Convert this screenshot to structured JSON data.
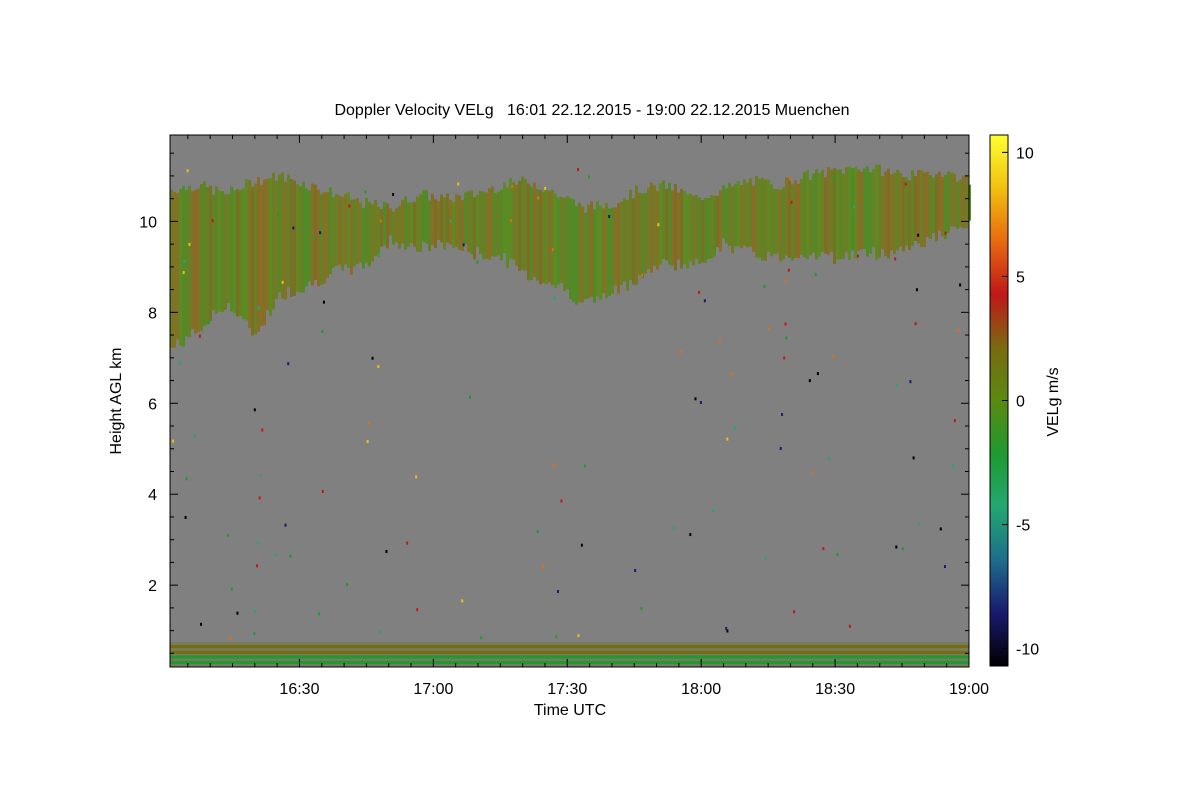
{
  "chart_data": {
    "type": "heatmap",
    "title": "Doppler Velocity VELg   16:01 22.12.2015 - 19:00 22.12.2015 Muenchen",
    "xlabel": "Time UTC",
    "ylabel": "Height AGL km",
    "colorbar_label": "VELg m/s",
    "x_ticks": [
      "16:30",
      "17:00",
      "17:30",
      "18:00",
      "18:30",
      "19:00"
    ],
    "x_tick_values_min": [
      30,
      60,
      90,
      120,
      150,
      180
    ],
    "xlim_min": [
      1,
      180
    ],
    "y_ticks": [
      "2",
      "4",
      "6",
      "8",
      "10"
    ],
    "y_tick_values": [
      2,
      4,
      6,
      8,
      10
    ],
    "ylim": [
      0.2,
      11.9
    ],
    "colorbar_ticks": [
      "10",
      "5",
      "0",
      "-5",
      "-10"
    ],
    "colorbar_tick_values": [
      10,
      5,
      0,
      -5,
      -10
    ],
    "clim": [
      -10.7,
      10.7
    ],
    "background_color": "#808080",
    "colormap": [
      "#000000",
      "#1a1a6e",
      "#1d6e8c",
      "#22a870",
      "#1e9a30",
      "#5a8a10",
      "#7a6a10",
      "#c01818",
      "#e86a10",
      "#f0c010",
      "#ffff30"
    ],
    "cloud_layer": {
      "description_values_m_s": [
        -1.5,
        1.5
      ],
      "top_km": [
        10.7,
        10.8,
        10.6,
        10.9,
        11.0,
        10.8,
        10.6,
        10.4,
        10.3,
        10.6,
        10.5,
        10.6,
        10.8,
        10.9,
        10.6,
        10.3,
        10.4,
        10.7,
        10.8,
        10.5,
        10.7,
        10.9,
        10.8,
        11.0,
        11.1,
        11.2,
        11.1,
        11.0,
        11.1,
        10.9
      ],
      "base_km": [
        7.2,
        7.6,
        8.2,
        7.5,
        8.4,
        8.6,
        8.9,
        9.0,
        9.6,
        9.4,
        9.5,
        9.3,
        9.2,
        8.8,
        8.6,
        8.2,
        8.4,
        8.8,
        9.1,
        9.0,
        9.5,
        9.3,
        9.2,
        9.3,
        9.2,
        9.3,
        9.3,
        9.5,
        9.7,
        9.9
      ]
    },
    "surface_bands_km": [
      {
        "height": 0.65,
        "velocity": 2
      },
      {
        "height": 0.52,
        "velocity": 2
      },
      {
        "height": 0.42,
        "velocity": -1.5
      },
      {
        "height": 0.3,
        "velocity": -3
      }
    ]
  }
}
